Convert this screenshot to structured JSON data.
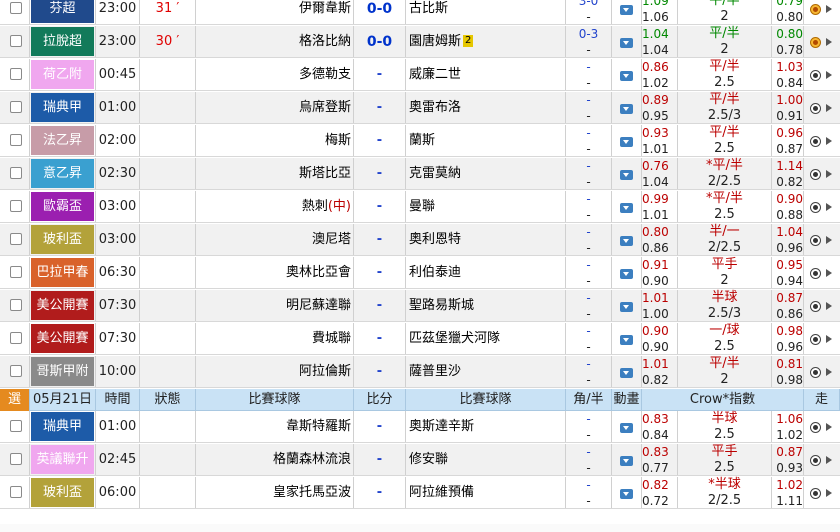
{
  "header": {
    "select": "選",
    "date": "05月21日",
    "time": "時間",
    "status": "狀態",
    "home": "比賽球隊",
    "score": "比分",
    "away": "比賽球隊",
    "handicap": "角/半",
    "anim": "動畫",
    "index": "Crow*指數",
    "more": "走"
  },
  "matches": [
    {
      "league": "芬超",
      "color": "#204a8c",
      "time": "23:00",
      "status": "31",
      "home": "伊爾韋斯",
      "score": "0-0",
      "away": "古比斯",
      "hc_top": "3-0",
      "hc_bot": "-",
      "o1_top": "1.09",
      "o1_bot": "1.06",
      "hl_top": "平/半",
      "hl_bot": "2",
      "o2_top": "0.79",
      "o2_bot": "0.80",
      "o1c": "grn",
      "o2c": "grn",
      "icon": "live"
    },
    {
      "league": "拉脫超",
      "color": "#127a5a",
      "time": "23:00",
      "status": "30",
      "home": "格洛比納",
      "score": "0-0",
      "away": "園唐姆斯",
      "away_card": "2",
      "hc_top": "0-3",
      "hc_bot": "-",
      "o1_top": "1.04",
      "o1_bot": "1.04",
      "hl_top": "平/半",
      "hl_bot": "2",
      "o2_top": "0.80",
      "o2_bot": "0.78",
      "o1c": "grn",
      "o2c": "grn",
      "icon": "live"
    },
    {
      "league": "荷乙附",
      "color": "#f0a7ef",
      "time": "00:45",
      "status": "",
      "home": "多德勒支",
      "score": "-",
      "away": "威廉二世",
      "hc_top": "-",
      "hc_bot": "-",
      "o1_top": "0.86",
      "o1_bot": "1.02",
      "hl_top": "平/半",
      "hl_bot": "2.5",
      "o2_top": "1.03",
      "o2_bot": "0.84",
      "o1c": "red",
      "o2c": "red",
      "icon": "ball"
    },
    {
      "league": "瑞典甲",
      "color": "#1d5ba8",
      "time": "01:00",
      "status": "",
      "home": "烏席登斯",
      "score": "-",
      "away": "奧雷布洛",
      "hc_top": "-",
      "hc_bot": "-",
      "o1_top": "0.89",
      "o1_bot": "0.95",
      "hl_top": "平/半",
      "hl_bot": "2.5/3",
      "o2_top": "1.00",
      "o2_bot": "0.91",
      "o1c": "red",
      "o2c": "red",
      "icon": "ball"
    },
    {
      "league": "法乙昇",
      "color": "#c79ca8",
      "time": "02:00",
      "status": "",
      "home": "梅斯",
      "score": "-",
      "away": "蘭斯",
      "hc_top": "-",
      "hc_bot": "-",
      "o1_top": "0.93",
      "o1_bot": "1.01",
      "hl_top": "平/半",
      "hl_bot": "2.5",
      "o2_top": "0.96",
      "o2_bot": "0.87",
      "o1c": "red",
      "o2c": "red",
      "icon": "ball"
    },
    {
      "league": "意乙昇",
      "color": "#3aa0d0",
      "time": "02:30",
      "status": "",
      "home": "斯塔比亞",
      "score": "-",
      "away": "克雷莫納",
      "hc_top": "-",
      "hc_bot": "-",
      "o1_top": "0.76",
      "o1_bot": "1.04",
      "hl_top": "*平/半",
      "hl_bot": "2/2.5",
      "o2_top": "1.14",
      "o2_bot": "0.82",
      "o1c": "red",
      "o2c": "red",
      "icon": "ball"
    },
    {
      "league": "歐霸盃",
      "color": "#9b1fb0",
      "time": "03:00",
      "status": "",
      "home": "熱刺",
      "home_tag": "(中)",
      "score": "-",
      "away": "曼聯",
      "hc_top": "-",
      "hc_bot": "-",
      "o1_top": "0.99",
      "o1_bot": "1.01",
      "hl_top": "*平/半",
      "hl_bot": "2.5",
      "o2_top": "0.90",
      "o2_bot": "0.88",
      "o1c": "red",
      "o2c": "red",
      "icon": "ball"
    },
    {
      "league": "玻利盃",
      "color": "#b3a23a",
      "time": "03:00",
      "status": "",
      "home": "澳尼塔",
      "score": "-",
      "away": "奧利恩特",
      "hc_top": "-",
      "hc_bot": "-",
      "o1_top": "0.80",
      "o1_bot": "0.86",
      "hl_top": "半/一",
      "hl_bot": "2/2.5",
      "o2_top": "1.04",
      "o2_bot": "0.96",
      "o1c": "red",
      "o2c": "red",
      "icon": "ball"
    },
    {
      "league": "巴拉甲春",
      "color": "#d9622b",
      "time": "06:30",
      "status": "",
      "home": "奧林比亞會",
      "score": "-",
      "away": "利伯泰迪",
      "hc_top": "-",
      "hc_bot": "-",
      "o1_top": "0.91",
      "o1_bot": "0.90",
      "hl_top": "平手",
      "hl_bot": "2",
      "o2_top": "0.95",
      "o2_bot": "0.94",
      "o1c": "red",
      "o2c": "red",
      "icon": "ball"
    },
    {
      "league": "美公開賽",
      "color": "#b11c1c",
      "time": "07:30",
      "status": "",
      "home": "明尼蘇達聯",
      "score": "-",
      "away": "聖路易斯城",
      "hc_top": "-",
      "hc_bot": "-",
      "o1_top": "1.01",
      "o1_bot": "1.00",
      "hl_top": "半球",
      "hl_bot": "2.5/3",
      "o2_top": "0.87",
      "o2_bot": "0.86",
      "o1c": "red",
      "o2c": "red",
      "icon": "ball"
    },
    {
      "league": "美公開賽",
      "color": "#b11c1c",
      "time": "07:30",
      "status": "",
      "home": "費城聯",
      "score": "-",
      "away": "匹茲堡獵犬河隊",
      "hc_top": "-",
      "hc_bot": "-",
      "o1_top": "0.90",
      "o1_bot": "0.90",
      "hl_top": "一/球",
      "hl_bot": "2.5",
      "o2_top": "0.98",
      "o2_bot": "0.96",
      "o1c": "red",
      "o2c": "red",
      "icon": "ball"
    },
    {
      "league": "哥斯甲附",
      "color": "#8a8a8a",
      "time": "10:00",
      "status": "",
      "home": "阿拉倫斯",
      "score": "-",
      "away": "薩普里沙",
      "hc_top": "-",
      "hc_bot": "-",
      "o1_top": "1.01",
      "o1_bot": "0.82",
      "hl_top": "平/半",
      "hl_bot": "2",
      "o2_top": "0.81",
      "o2_bot": "0.98",
      "o1c": "red",
      "o2c": "red",
      "icon": "ball"
    }
  ],
  "matches2": [
    {
      "league": "瑞典甲",
      "color": "#1d5ba8",
      "time": "01:00",
      "status": "",
      "home": "韋斯特羅斯",
      "score": "-",
      "away": "奧斯達辛斯",
      "hc_top": "-",
      "hc_bot": "-",
      "o1_top": "0.83",
      "o1_bot": "0.84",
      "hl_top": "半球",
      "hl_bot": "2.5",
      "o2_top": "1.06",
      "o2_bot": "1.02",
      "o1c": "red",
      "o2c": "red",
      "icon": "ball"
    },
    {
      "league": "英議聯升",
      "color": "#f0a7ef",
      "time": "02:45",
      "status": "",
      "home": "格蘭森林流浪",
      "score": "-",
      "away": "修安聯",
      "hc_top": "-",
      "hc_bot": "-",
      "o1_top": "0.83",
      "o1_bot": "0.77",
      "hl_top": "平手",
      "hl_bot": "2.5",
      "o2_top": "0.87",
      "o2_bot": "0.93",
      "o1c": "red",
      "o2c": "red",
      "icon": "ball"
    },
    {
      "league": "玻利盃",
      "color": "#b3a23a",
      "time": "06:00",
      "status": "",
      "home": "皇家托馬亞波",
      "score": "-",
      "away": "阿拉維預備",
      "hc_top": "-",
      "hc_bot": "-",
      "o1_top": "0.82",
      "o1_bot": "0.72",
      "hl_top": "*半球",
      "hl_bot": "2/2.5",
      "o2_top": "1.02",
      "o2_bot": "1.11",
      "o1c": "red",
      "o2c": "red",
      "icon": "ball"
    }
  ]
}
